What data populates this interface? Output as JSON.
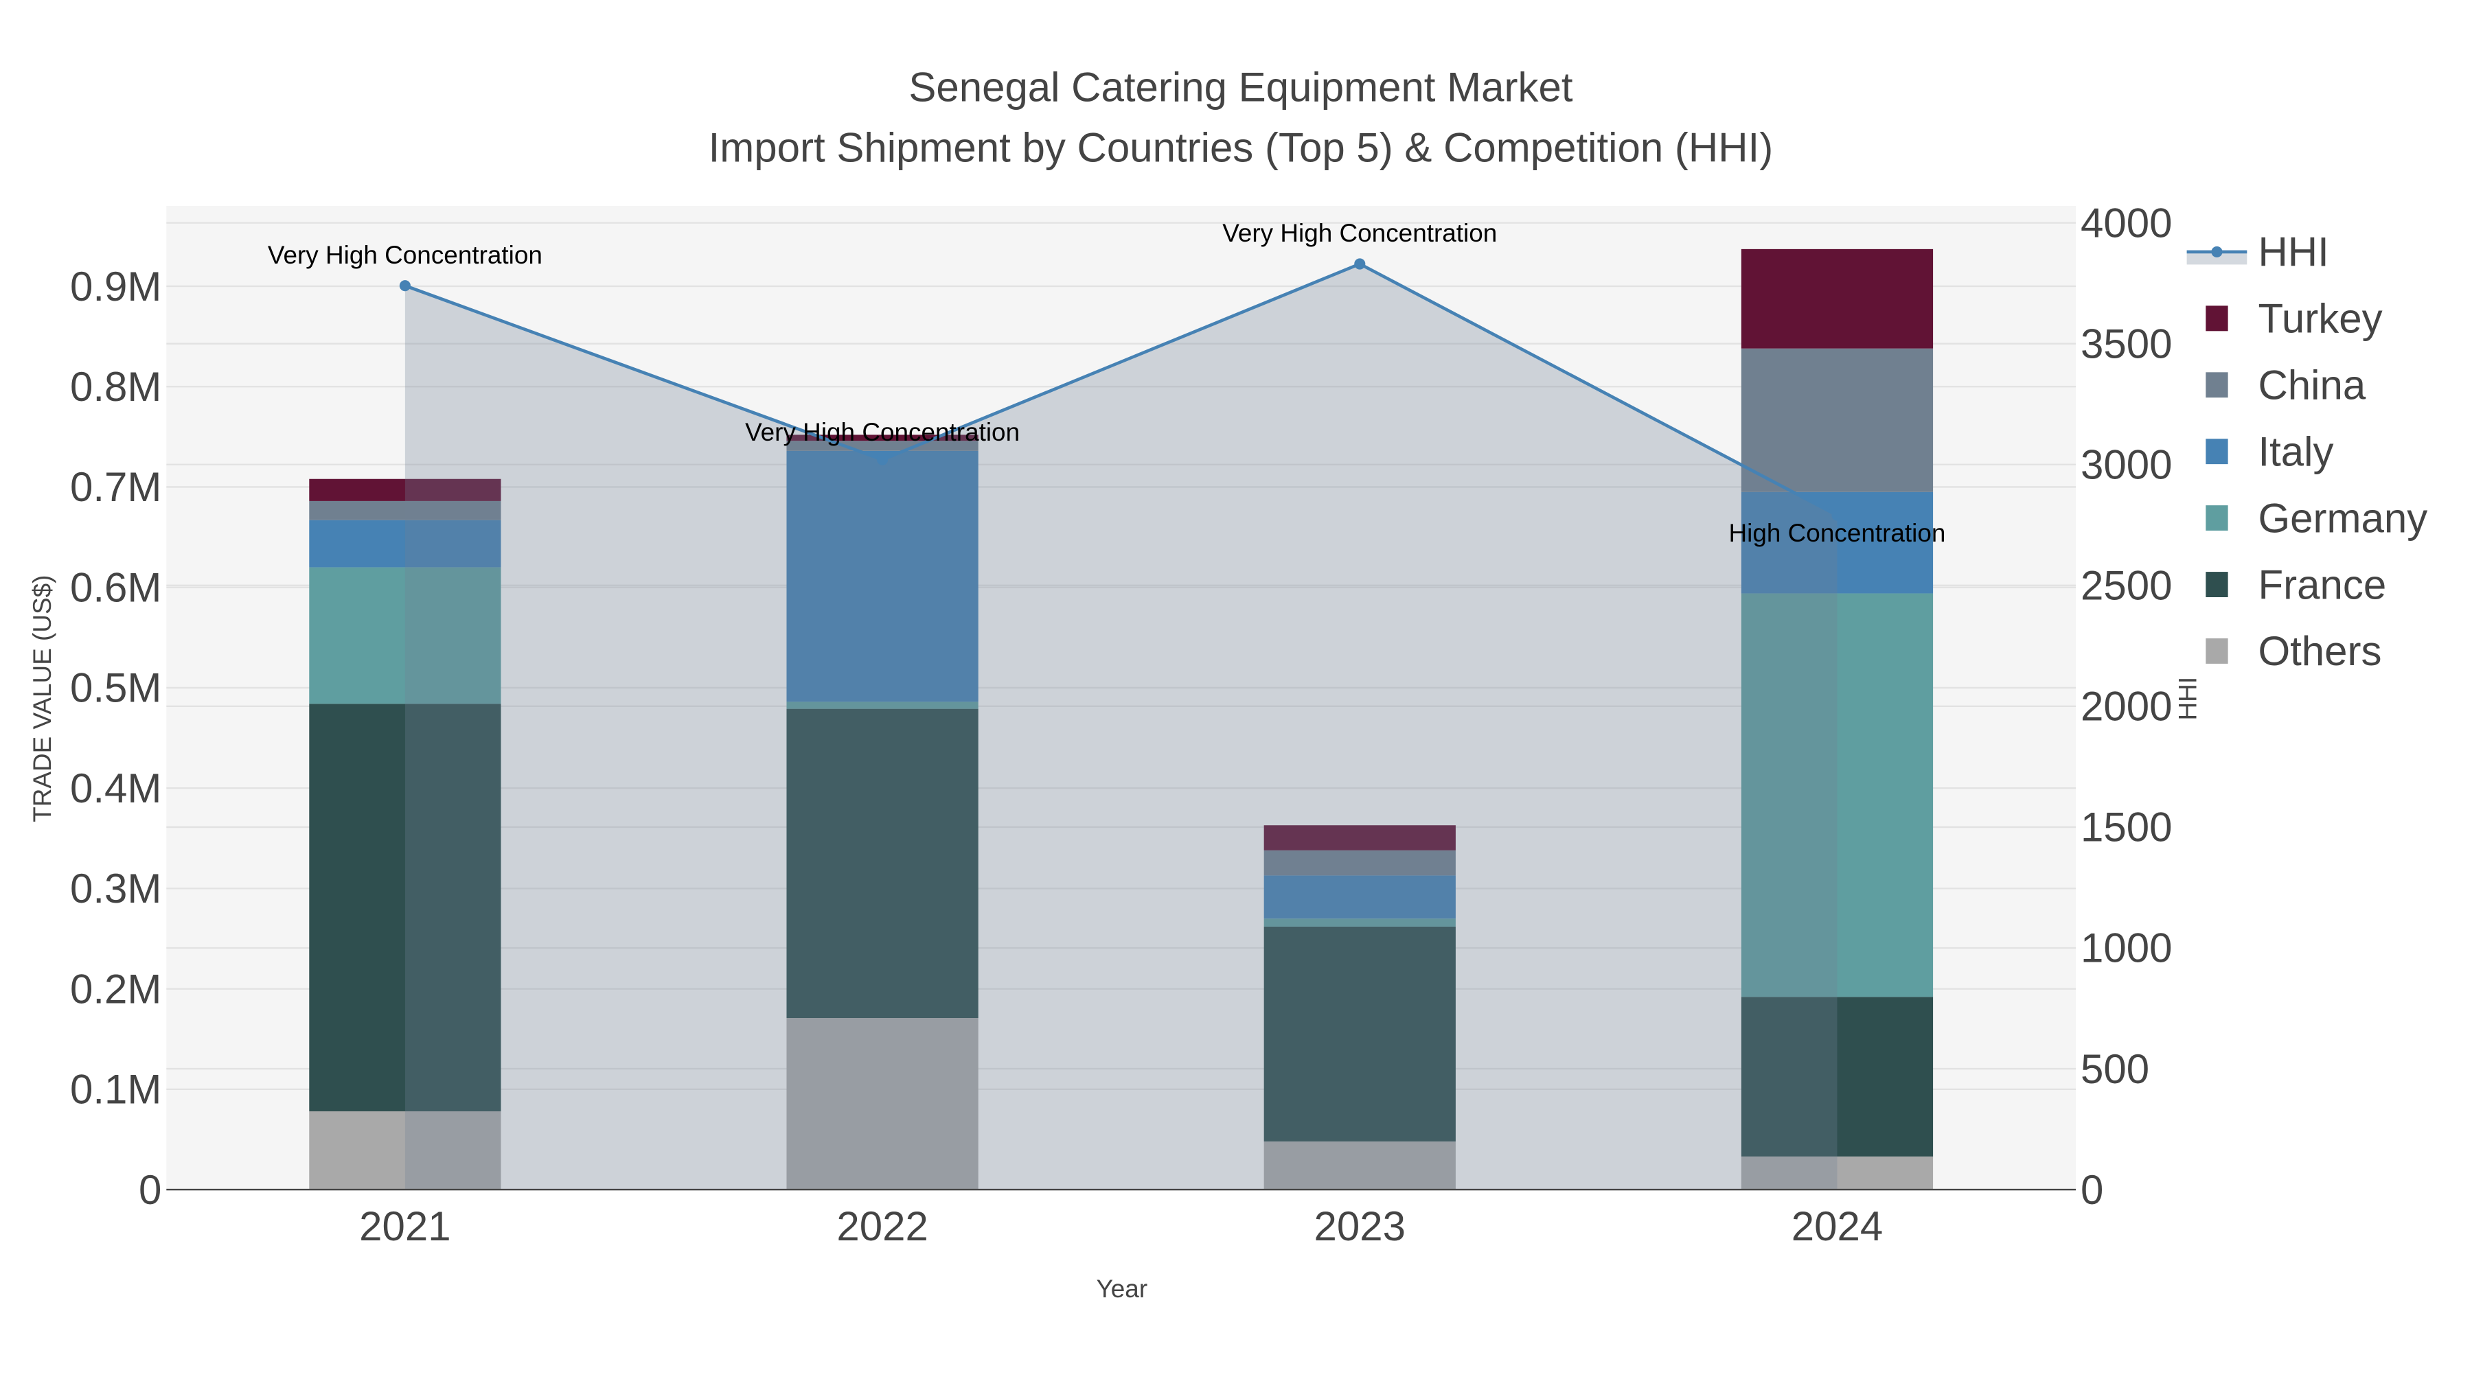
{
  "chart_data": {
    "type": "bar",
    "title": "Senegal Catering Equipment Market",
    "subtitle": "Import Shipment by Countries (Top 5) & Competition (HHI)",
    "xlabel": "Year",
    "ylabel": "TRADE VALUE (US$)",
    "y2label": "HHI",
    "categories": [
      "2021",
      "2022",
      "2023",
      "2024"
    ],
    "ylim": [
      0,
      0.98
    ],
    "y_unit": "M",
    "y_ticks": [
      0,
      0.1,
      0.2,
      0.3,
      0.4,
      0.5,
      0.6,
      0.7,
      0.8,
      0.9
    ],
    "y_tick_labels": [
      "0",
      "0.1M",
      "0.2M",
      "0.3M",
      "0.4M",
      "0.5M",
      "0.6M",
      "0.7M",
      "0.8M",
      "0.9M"
    ],
    "y2lim": [
      0,
      4070
    ],
    "y2_ticks": [
      0,
      500,
      1000,
      1500,
      2000,
      2500,
      3000,
      3500,
      4000
    ],
    "y2_tick_labels": [
      "0",
      "500",
      "1000",
      "1500",
      "2000",
      "2500",
      "3000",
      "3500",
      "4000"
    ],
    "grid": true,
    "legend_position": "right",
    "series": [
      {
        "name": "Others",
        "color": "#a9a9a9",
        "values": [
          0.078,
          0.171,
          0.048,
          0.033
        ]
      },
      {
        "name": "France",
        "color": "#2f4f4f",
        "values": [
          0.406,
          0.308,
          0.214,
          0.159
        ]
      },
      {
        "name": "Germany",
        "color": "#5f9ea0",
        "values": [
          0.136,
          0.007,
          0.008,
          0.402
        ]
      },
      {
        "name": "Italy",
        "color": "#4682b4",
        "values": [
          0.047,
          0.25,
          0.043,
          0.101
        ]
      },
      {
        "name": "China",
        "color": "#708090",
        "values": [
          0.019,
          0.01,
          0.025,
          0.143
        ]
      },
      {
        "name": "Turkey",
        "color": "#611335",
        "values": [
          0.022,
          0.006,
          0.025,
          0.099
        ]
      }
    ],
    "hhi": {
      "name": "HHI",
      "color": "#4682b4",
      "values": [
        3740,
        3020,
        3830,
        2790
      ],
      "annotations": [
        "Very High Concentration",
        "Very High Concentration",
        "Very High Concentration",
        "High Concentration"
      ]
    },
    "legend_order": [
      "HHI",
      "Turkey",
      "China",
      "Italy",
      "Germany",
      "France",
      "Others"
    ]
  }
}
